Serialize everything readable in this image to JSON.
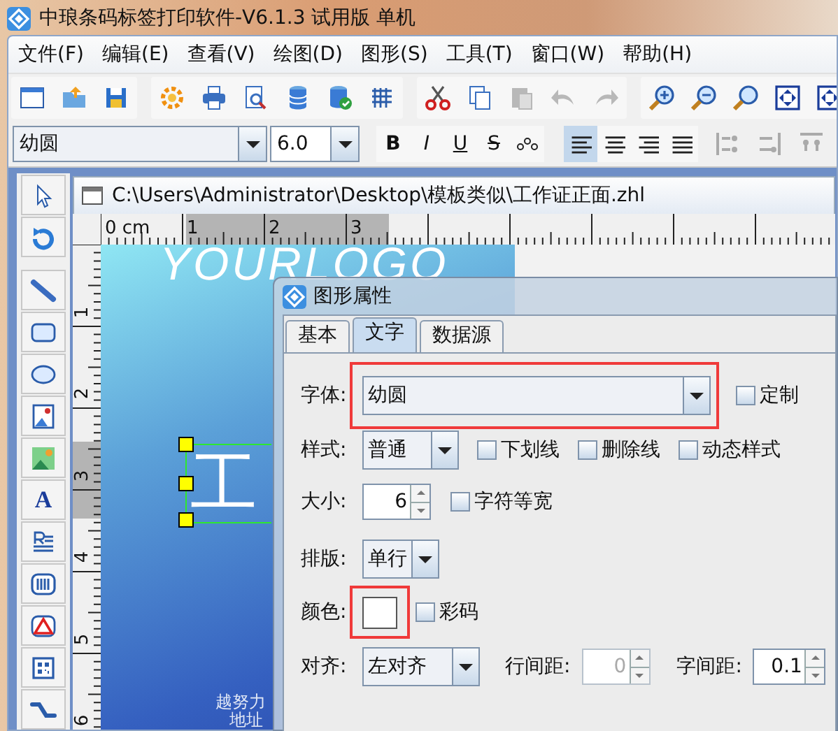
{
  "app": {
    "title": "中琅条码标签打印软件-V6.1.3 试用版 单机"
  },
  "menu": [
    "文件(F)",
    "编辑(E)",
    "查看(V)",
    "绘图(D)",
    "图形(S)",
    "工具(T)",
    "窗口(W)",
    "帮助(H)"
  ],
  "toolbar": [
    {
      "buttons": [
        {
          "kind": "new",
          "disabled": false
        },
        {
          "kind": "open",
          "disabled": false
        },
        {
          "kind": "save",
          "disabled": false
        }
      ]
    },
    {
      "buttons": [
        {
          "kind": "settings",
          "disabled": false
        },
        {
          "kind": "print",
          "disabled": false
        },
        {
          "kind": "preview",
          "disabled": false
        },
        {
          "kind": "database",
          "disabled": false
        },
        {
          "kind": "database-check",
          "disabled": false
        },
        {
          "kind": "grid",
          "disabled": false
        }
      ]
    },
    {
      "buttons": [
        {
          "kind": "cut",
          "disabled": false
        },
        {
          "kind": "copy",
          "disabled": false
        },
        {
          "kind": "paste",
          "disabled": true
        },
        {
          "kind": "undo",
          "disabled": true
        },
        {
          "kind": "redo",
          "disabled": true
        }
      ]
    },
    {
      "buttons": [
        {
          "kind": "zoom-in",
          "disabled": false
        },
        {
          "kind": "zoom-out",
          "disabled": false
        },
        {
          "kind": "zoom",
          "disabled": false
        },
        {
          "kind": "fit",
          "disabled": false
        },
        {
          "kind": "fit-page",
          "disabled": false
        }
      ]
    }
  ],
  "format_bar": {
    "font": "幼圆",
    "size": "6.0",
    "styles": [
      {
        "kind": "bold",
        "label": "B"
      },
      {
        "kind": "italic",
        "label": "I"
      },
      {
        "kind": "underline",
        "label": "U"
      },
      {
        "kind": "strike",
        "label": "S"
      },
      {
        "kind": "spacing"
      }
    ],
    "alignment": [
      {
        "kind": "left",
        "selected": true
      },
      {
        "kind": "center",
        "selected": false
      },
      {
        "kind": "right",
        "selected": false
      },
      {
        "kind": "justify",
        "selected": false
      }
    ],
    "arrange": [
      {
        "kind": "left",
        "disabled": true
      },
      {
        "kind": "right",
        "disabled": true
      },
      {
        "kind": "top",
        "disabled": true
      }
    ]
  },
  "tools": [
    {
      "buttons": [
        {
          "kind": "pointer"
        },
        {
          "kind": "rotate"
        }
      ]
    },
    {
      "buttons": [
        {
          "kind": "line"
        },
        {
          "kind": "rectangle"
        },
        {
          "kind": "ellipse"
        },
        {
          "kind": "image"
        },
        {
          "kind": "picture"
        },
        {
          "kind": "text",
          "label": "A"
        },
        {
          "kind": "rich-text"
        },
        {
          "kind": "barcode"
        },
        {
          "kind": "logo"
        },
        {
          "kind": "qr"
        },
        {
          "kind": "curve"
        }
      ]
    }
  ],
  "document": {
    "title": "C:\\Users\\Administrator\\Desktop\\模板类似\\工作证正面.zhl",
    "top_ruler": [
      "0 cm",
      "1",
      "2",
      "3"
    ],
    "left_ruler": [
      "1",
      "2",
      "3",
      "4",
      "5",
      "6"
    ],
    "label": {
      "logo": "YOURLOGO",
      "heading": "工",
      "motto": "越努力",
      "address": "地址"
    }
  },
  "dialog": {
    "title": "图形属性",
    "tabs": [
      {
        "label": "基本",
        "selected": false
      },
      {
        "label": "文字",
        "selected": true
      },
      {
        "label": "数据源",
        "selected": false
      }
    ],
    "font": {
      "label": "字体:",
      "value": "幼圆",
      "highlighted": true
    },
    "custom": {
      "label": "定制",
      "checked": false
    },
    "style": {
      "label": "样式:",
      "value": "普通"
    },
    "style_options": [
      {
        "label": "下划线",
        "checked": false
      },
      {
        "label": "删除线",
        "checked": false
      },
      {
        "label": "动态样式",
        "checked": false
      }
    ],
    "size": {
      "label": "大小:",
      "value": "6"
    },
    "monospace": {
      "label": "字符等宽",
      "checked": false
    },
    "layout": {
      "label": "排版:",
      "value": "单行"
    },
    "color": {
      "label": "颜色:",
      "color": "#ffffff",
      "highlighted": true
    },
    "color_code": {
      "label": "彩码",
      "checked": false
    },
    "align": {
      "label": "对齐:",
      "value": "左对齐"
    },
    "line_spacing": {
      "label": "行间距:",
      "value": "0",
      "disabled": true
    },
    "char_spacing": {
      "label": "字间距:",
      "value": "0.1",
      "disabled": false
    }
  }
}
